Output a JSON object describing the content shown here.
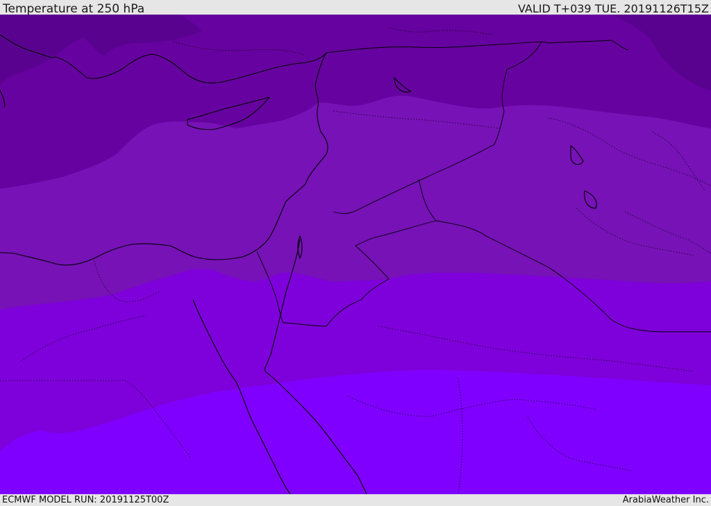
{
  "header": {
    "title": "Temperature at 250 hPa",
    "valid_time": "VALID T+039 TUE. 20191126T15Z"
  },
  "footer": {
    "model_run": "ECMWF MODEL RUN: 20191125T00Z",
    "credit": "ArabiaWeather Inc."
  },
  "map": {
    "colors": {
      "band_coldest": "#5a0290",
      "band_cold": "#66029f",
      "band_mid": "#7612b6",
      "band_warm": "#7e00da",
      "band_warmest": "#7f00ff",
      "coastline": "#000000"
    }
  }
}
